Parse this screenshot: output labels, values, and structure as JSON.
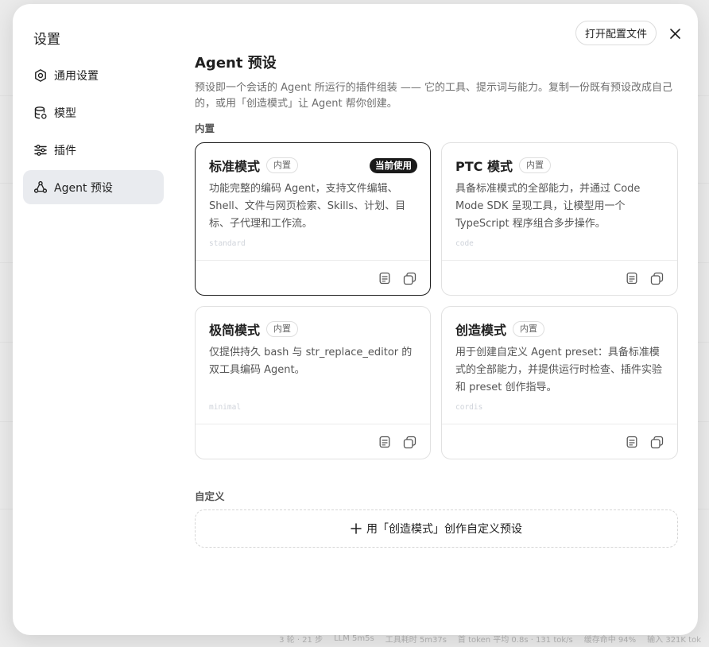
{
  "modal": {
    "title": "设置",
    "open_config_label": "打开配置文件"
  },
  "nav": {
    "items": [
      {
        "label": "通用设置",
        "icon": "gear-icon"
      },
      {
        "label": "模型",
        "icon": "database-icon"
      },
      {
        "label": "插件",
        "icon": "sliders-icon"
      },
      {
        "label": "Agent 预设",
        "icon": "agent-icon",
        "active": true
      }
    ]
  },
  "page": {
    "title": "Agent 预设",
    "description": "预设即一个会话的 Agent 所运行的插件组装 —— 它的工具、提示词与能力。复制一份既有预设改成自己的，或用「创造模式」让 Agent 帮你创建。",
    "builtin_section": "内置",
    "custom_section": "自定义",
    "create_label": "用「创造模式」创作自定义预设"
  },
  "presets": [
    {
      "name": "标准模式",
      "badge": "内置",
      "current_label": "当前使用",
      "description": "功能完整的编码 Agent，支持文件编辑、Shell、文件与网页检索、Skills、计划、目标、子代理和工作流。",
      "id": "standard"
    },
    {
      "name": "PTC 模式",
      "badge": "内置",
      "description": "具备标准模式的全部能力，并通过 Code Mode SDK 呈现工具，让模型用一个 TypeScript 程序组合多步操作。",
      "id": "code"
    },
    {
      "name": "极简模式",
      "badge": "内置",
      "description": "仅提供持久 bash 与 str_replace_editor 的双工具编码 Agent。",
      "id": "minimal"
    },
    {
      "name": "创造模式",
      "badge": "内置",
      "description": "用于创建自定义 Agent preset：具备标准模式的全部能力，并提供运行时检查、插件实验和 preset 创作指导。",
      "id": "cordis"
    }
  ],
  "statusbar": {
    "items": [
      "3 轮 · 21 步",
      "LLM 5m5s",
      "工具耗时 5m37s",
      "首 token 平均 0.8s · 131 tok/s",
      "缓存命中 94%",
      "输入 321K tok"
    ]
  }
}
